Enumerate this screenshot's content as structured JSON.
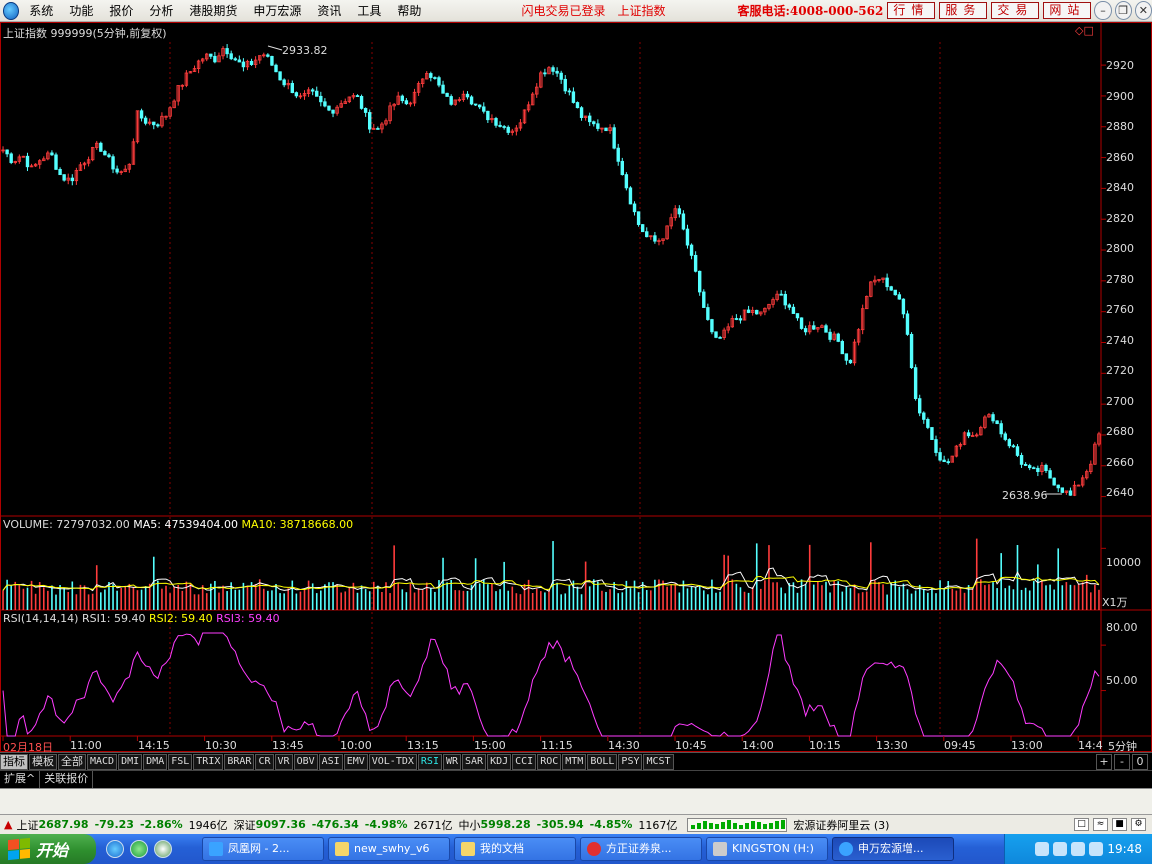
{
  "menubar": {
    "items": [
      "系统",
      "功能",
      "报价",
      "分析",
      "港股期货",
      "申万宏源",
      "资讯",
      "工具",
      "帮助"
    ],
    "status": [
      "闪电交易已登录",
      "上证指数"
    ],
    "hotline": "客服电话:4008-000-562",
    "buttons": [
      "行情",
      "服务",
      "交易",
      "网站"
    ]
  },
  "chart": {
    "title": "上证指数 999999(5分钟,前复权)",
    "high_label": "2933.82",
    "low_label": "2638.96",
    "volume_header": {
      "name": "VOLUME:",
      "value": "72797032.00",
      "ma5": "MA5: 47539404.00",
      "ma10": "MA10: 38718668.00"
    },
    "rsi_header": {
      "name": "RSI(14,14,14)",
      "rsi1": "RSI1: 59.40",
      "rsi2": "RSI2: 59.40",
      "rsi3": "RSI3: 59.40"
    },
    "price_ticks": [
      "2920",
      "2900",
      "2880",
      "2860",
      "2840",
      "2820",
      "2800",
      "2780",
      "2760",
      "2740",
      "2720",
      "2700",
      "2680",
      "2660",
      "2640"
    ],
    "volume_tick": "10000",
    "volume_unit": "X1万",
    "rsi_ticks": [
      "80.00",
      "50.00"
    ],
    "time_labels": [
      "02月18日",
      "11:00",
      "14:15",
      "10:30",
      "13:45",
      "10:00",
      "13:15",
      "15:00",
      "11:15",
      "14:30",
      "10:45",
      "14:00",
      "10:15",
      "13:30",
      "09:45",
      "13:00",
      "14:4"
    ],
    "period": "5分钟",
    "colors": {
      "up": "#ff3c3c",
      "down": "#54ffff",
      "ma5": "#ffffff",
      "ma10": "#ffff00",
      "rsi": "#ff3cff",
      "grid": "#8a0000"
    }
  },
  "chart_data": {
    "type": "candlestick",
    "title": "上证指数 999999(5分钟,前复权)",
    "ylim": [
      2630,
      2935
    ],
    "price_path": [
      2865,
      2858,
      2862,
      2852,
      2860,
      2862,
      2848,
      2845,
      2855,
      2862,
      2868,
      2858,
      2850,
      2852,
      2888,
      2883,
      2882,
      2888,
      2902,
      2912,
      2920,
      2926,
      2924,
      2932,
      2925,
      2918,
      2922,
      2928,
      2920,
      2910,
      2905,
      2898,
      2902,
      2895,
      2890,
      2895,
      2900,
      2898,
      2882,
      2878,
      2888,
      2898,
      2895,
      2902,
      2918,
      2910,
      2898,
      2895,
      2905,
      2895,
      2888,
      2885,
      2880,
      2878,
      2885,
      2902,
      2915,
      2920,
      2912,
      2900,
      2888,
      2882,
      2880,
      2880,
      2860,
      2838,
      2818,
      2808,
      2805,
      2812,
      2828,
      2808,
      2785,
      2760,
      2740,
      2745,
      2755,
      2758,
      2760,
      2758,
      2768,
      2770,
      2762,
      2748,
      2750,
      2752,
      2745,
      2740,
      2725,
      2750,
      2775,
      2782,
      2778,
      2770,
      2752,
      2700,
      2688,
      2672,
      2660,
      2668,
      2682,
      2680,
      2690,
      2692,
      2680,
      2672,
      2662,
      2655,
      2658,
      2652,
      2646,
      2640,
      2650,
      2660,
      2680
    ],
    "volume_ylim": [
      0,
      12000
    ],
    "rsi_ylim": [
      20,
      90
    ],
    "rsi_last": 59.4
  },
  "tabs": {
    "indicators": [
      "指标",
      "模板",
      "全部",
      "MACD",
      "DMI",
      "DMA",
      "FSL",
      "TRIX",
      "BRAR",
      "CR",
      "VR",
      "OBV",
      "ASI",
      "EMV",
      "VOL-TDX",
      "RSI",
      "WR",
      "SAR",
      "KDJ",
      "CCI",
      "ROC",
      "MTM",
      "BOLL",
      "PSY",
      "MCST"
    ],
    "controls": [
      "+",
      "-",
      "0"
    ],
    "sub": [
      "扩展^",
      "关联报价"
    ]
  },
  "statusbar": {
    "sh_label": "上证",
    "sh_value": "2687.98",
    "sh_change": "-79.23",
    "sh_pct": "-2.86%",
    "sh_amount": "1946亿",
    "sz_label": "深证",
    "sz_value": "9097.36",
    "sz_change": "-476.34",
    "sz_pct": "-4.98%",
    "sz_amount": "2671亿",
    "zx_label": "中小",
    "zx_value": "5998.28",
    "zx_change": "-305.94",
    "zx_pct": "-4.85%",
    "zx_amount": "1167亿",
    "broker": "宏源证券阿里云 (3)"
  },
  "taskbar": {
    "start": "开始",
    "tasks": [
      "凤凰网 - 2...",
      "new_swhy_v6",
      "我的文档",
      "方正证券泉...",
      "KINGSTON (H:)",
      "申万宏源增..."
    ],
    "clock": "19:48"
  }
}
